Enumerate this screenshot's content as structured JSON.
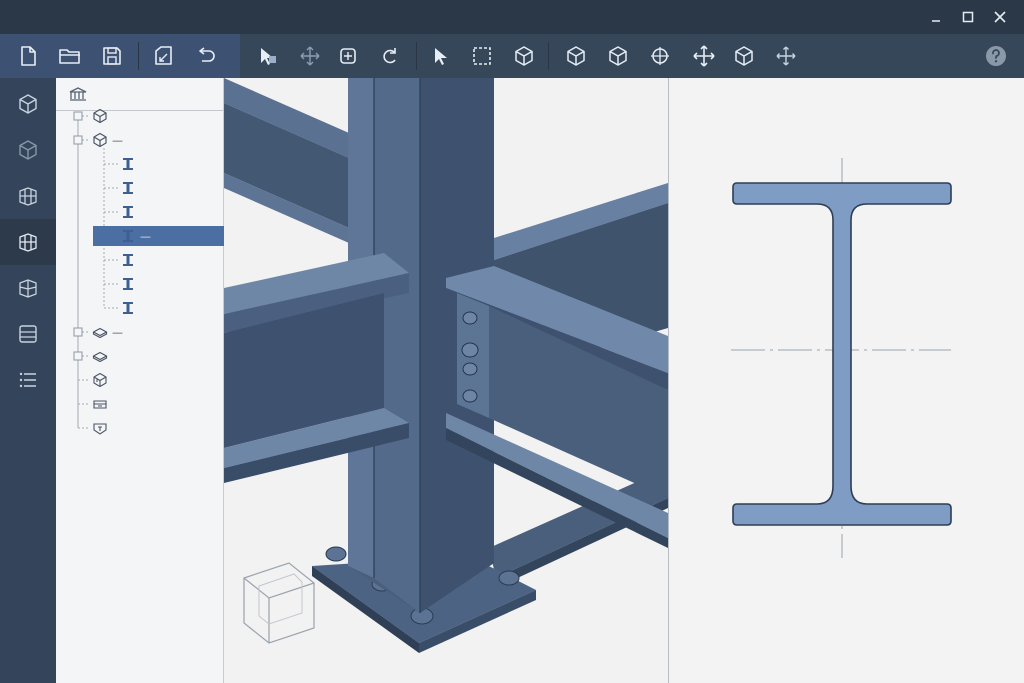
{
  "window": {
    "controls": [
      "minimize-icon",
      "maximize-icon",
      "close-icon"
    ]
  },
  "toolbar": {
    "file_group": [
      "new-file-icon",
      "open-folder-icon",
      "save-icon",
      "save-as-icon",
      "undo-icon"
    ],
    "tools": [
      "select-object-icon",
      "move-icon",
      "snap-icon",
      "rotate-icon",
      "pointer-icon",
      "box-select-icon",
      "cube-icon",
      "view-iso-icon",
      "view-front-icon",
      "crosshair-icon",
      "pan-icon",
      "view-top-icon",
      "orbit-icon"
    ],
    "help": "help-icon"
  },
  "rail": {
    "items": [
      "model-cube-icon",
      "model-outline-icon",
      "frame-icon",
      "frame-active-icon",
      "section-icon",
      "layers-icon",
      "list-icon"
    ],
    "active_index": 3
  },
  "tree": {
    "header_icon": "structure-building-icon",
    "selected_index": 5,
    "nodes": [
      {
        "icon": "cube-icon",
        "label": "",
        "depth": 0
      },
      {
        "icon": "cube-icon",
        "label": "—",
        "depth": 0
      },
      {
        "icon": "i-beam-icon",
        "label": "",
        "depth": 1
      },
      {
        "icon": "i-beam-icon",
        "label": "",
        "depth": 1
      },
      {
        "icon": "i-beam-icon",
        "label": "",
        "depth": 1
      },
      {
        "icon": "i-beam-icon",
        "label": "—",
        "depth": 1
      },
      {
        "icon": "i-beam-icon",
        "label": "",
        "depth": 1
      },
      {
        "icon": "i-beam-icon",
        "label": "",
        "depth": 1
      },
      {
        "icon": "i-beam-icon",
        "label": "",
        "depth": 1
      },
      {
        "icon": "plate-icon",
        "label": "—",
        "depth": 0
      },
      {
        "icon": "plate-icon",
        "label": "",
        "depth": 0
      },
      {
        "icon": "box-component-icon",
        "label": "",
        "depth": 0
      },
      {
        "icon": "tray-component-icon",
        "label": "",
        "depth": 0
      },
      {
        "icon": "connector-component-icon",
        "label": "",
        "depth": 0
      }
    ]
  },
  "colors": {
    "steel": "#4a5f7c",
    "steel_light": "#6f87a6",
    "steel_dark": "#344660",
    "profile_fill": "#7f9cc4",
    "selection": "#4b6ea3"
  }
}
